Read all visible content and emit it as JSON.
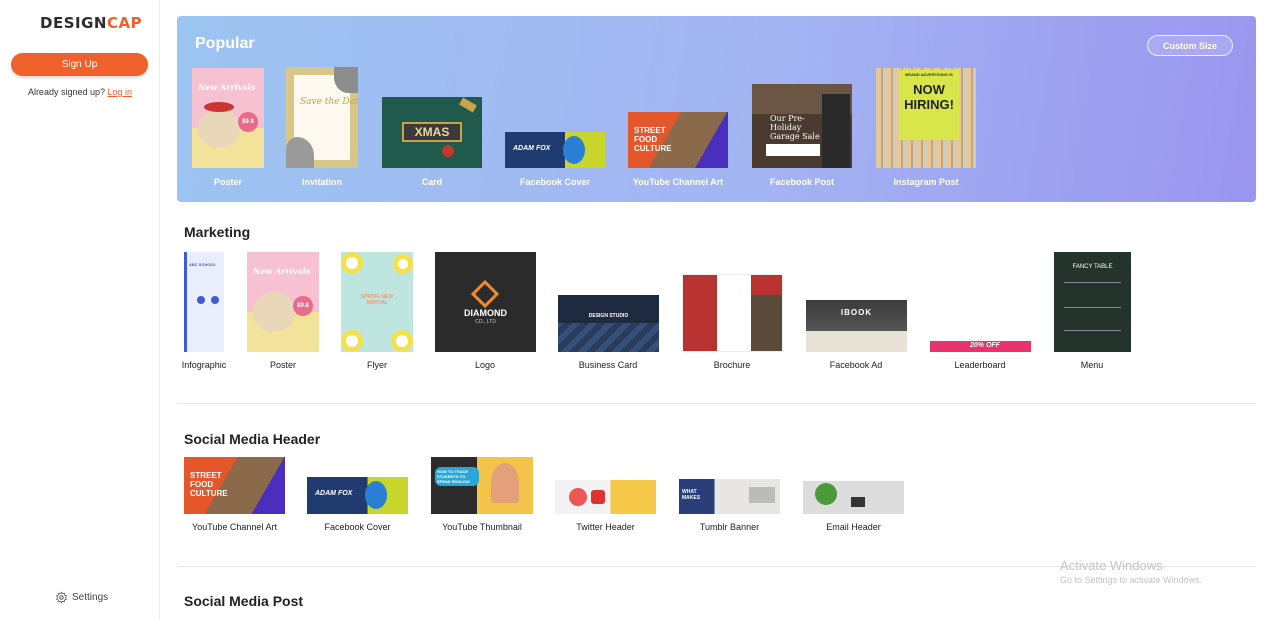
{
  "brand": {
    "part1": "DESIGN",
    "part2": "CAP"
  },
  "sidebar": {
    "signup_label": "Sign Up",
    "already_text": "Already signed up?",
    "login_label": "Log in",
    "settings_label": "Settings"
  },
  "popular": {
    "title": "Popular",
    "custom_size_label": "Custom Size",
    "items": [
      {
        "label": "Poster",
        "thumb_text": "New Arrivals",
        "price": "$9.8"
      },
      {
        "label": "Invitation",
        "thumb_text": "Save the Date"
      },
      {
        "label": "Card",
        "thumb_text": "XMAS"
      },
      {
        "label": "Facebook Cover",
        "thumb_text": "ADAM FOX"
      },
      {
        "label": "YouTube Channel Art",
        "thumb_text": "STREET FOOD CULTURE"
      },
      {
        "label": "Facebook Post",
        "thumb_text": "Our Pre-Holiday Garage Sale"
      },
      {
        "label": "Instagram Post",
        "thumb_text": "NOW HIRING!",
        "thumb_text2": "BRAND ADVERTISING IS"
      }
    ]
  },
  "marketing": {
    "title": "Marketing",
    "items": [
      {
        "label": "Infographic",
        "thumb_text": "ABC SCHOOL"
      },
      {
        "label": "Poster",
        "thumb_text": "New Arrivals",
        "price": "$9.8"
      },
      {
        "label": "Flyer",
        "thumb_text": "SPRING NEW ARRIVAL"
      },
      {
        "label": "Logo",
        "thumb_text": "DIAMOND",
        "thumb_text2": "CO., LTD"
      },
      {
        "label": "Business Card",
        "thumb_text": "DESIGN STUDIO"
      },
      {
        "label": "Brochure"
      },
      {
        "label": "Facebook Ad",
        "thumb_text": "IBOOK"
      },
      {
        "label": "Leaderboard",
        "thumb_text": "20% OFF"
      },
      {
        "label": "Menu",
        "thumb_text": "FANCY TABLE"
      }
    ]
  },
  "social_header": {
    "title": "Social Media Header",
    "items": [
      {
        "label": "YouTube Channel Art",
        "thumb_text": "STREET FOOD CULTURE"
      },
      {
        "label": "Facebook Cover",
        "thumb_text": "ADAM FOX"
      },
      {
        "label": "YouTube Thumbnail",
        "thumb_text": "HOW TO TEACH STUDENTS TO SPEAK ENGLISH"
      },
      {
        "label": "Twitter Header"
      },
      {
        "label": "Tumblr Banner",
        "thumb_text": "WHAT MAKES"
      },
      {
        "label": "Email Header"
      }
    ]
  },
  "social_post": {
    "title": "Social Media Post"
  },
  "watermark": {
    "line1": "Activate Windows",
    "line2": "Go to Settings to activate Windows."
  },
  "colors": {
    "accent": "#f0602a",
    "popular_gradient_start": "#9cc4f1",
    "popular_gradient_end": "#9a95ef"
  }
}
